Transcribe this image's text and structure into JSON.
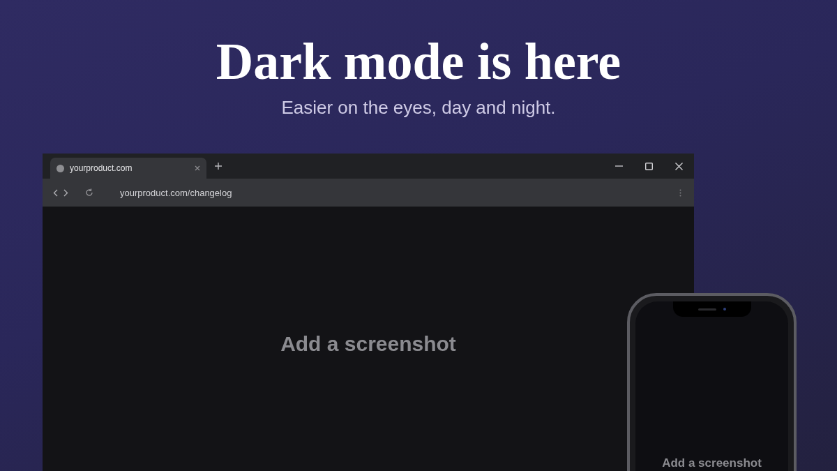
{
  "headline": "Dark mode is here",
  "subtitle": "Easier on the eyes, day and night.",
  "browser": {
    "tabs": [
      {
        "title": "yourproduct.com",
        "selected": true
      }
    ],
    "address": "yourproduct.com/changelog",
    "content_label": "Add a screenshot"
  },
  "phone": {
    "content_label": "Add a screenshot"
  }
}
